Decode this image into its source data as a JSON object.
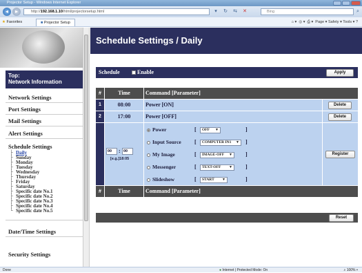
{
  "browser": {
    "window_title": "Projector Setup - Windows Internet Explorer",
    "url_prefix": "http://",
    "url_host": "192.168.1.10",
    "url_path": "/html/projectorsetup.html",
    "search_placeholder": "Bing",
    "favorites_label": "Favorites",
    "tab_label": "Projector Setup",
    "tools_menu": "Page ▾  Safety ▾  Tools ▾",
    "status_left": "Done",
    "status_zone": "Internet | Protected Mode: On",
    "status_zoom": "100%"
  },
  "sidebar": {
    "top_label": "Top:",
    "top_sub": "Network Information",
    "items": [
      "Network Settings",
      "Port Settings",
      "Mail Settings",
      "Alert Settings",
      "Schedule Settings"
    ],
    "sub_items": [
      "Daily",
      "Sunday",
      "Monday",
      "Tuesday",
      "Wednesday",
      "Thursday",
      "Friday",
      "Saturday",
      "Specific date No.1",
      "Specific date No.2",
      "Specific date No.3",
      "Specific date No.4",
      "Specific date No.5"
    ],
    "bottom_items": [
      "Date/Time Settings",
      "Security Settings"
    ]
  },
  "main": {
    "title": "Schedule Settings / Daily",
    "schedule_label": "Schedule",
    "enable_label": "Enable",
    "apply_label": "Apply",
    "header": {
      "num": "#",
      "time": "Time",
      "command": "Command [Parameter]"
    },
    "rows": [
      {
        "num": "1",
        "time": "08:00",
        "command": "Power [ON]",
        "action": "Delete"
      },
      {
        "num": "2",
        "time": "17:00",
        "command": "Power [OFF]",
        "action": "Delete"
      }
    ],
    "new_entry": {
      "hour": "00",
      "colon": ":",
      "minute": "00",
      "example": "[e.g.]18:05",
      "register_label": "Register",
      "options": [
        {
          "label": "Power",
          "value": "OFF",
          "selected": true
        },
        {
          "label": "Input Source",
          "value": "COMPUTER IN1",
          "selected": false
        },
        {
          "label": "My Image",
          "value": "IMAGE-OFF",
          "selected": false
        },
        {
          "label": "Messenger",
          "value": "TEXT-OFF",
          "selected": false
        },
        {
          "label": "Slideshow",
          "value": "START",
          "selected": false
        }
      ]
    },
    "reset_label": "Reset"
  }
}
